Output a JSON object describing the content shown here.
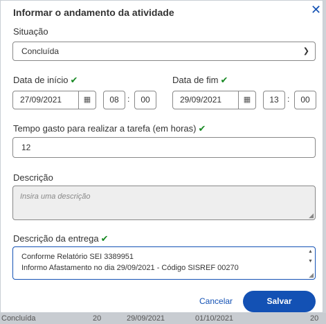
{
  "dialog": {
    "title": "Informar o andamento da atividade",
    "close_glyph": "✕"
  },
  "situacao": {
    "label": "Situação",
    "value": "Concluída"
  },
  "data_inicio": {
    "label": "Data de início",
    "date": "27/09/2021",
    "hour": "08",
    "minute": "00"
  },
  "data_fim": {
    "label": "Data de fim",
    "date": "29/09/2021",
    "hour": "13",
    "minute": "00"
  },
  "tempo": {
    "label": "Tempo gasto para realizar a tarefa (em horas)",
    "value": "12"
  },
  "descricao": {
    "label": "Descrição",
    "placeholder": "Insira uma descrição"
  },
  "descricao_entrega": {
    "label": "Descrição da entrega",
    "line1": "Conforme Relatório SEI 3389951",
    "line2": "Informo Afastamento no dia 29/09/2021 - Código SISREF 00270"
  },
  "actions": {
    "cancel": "Cancelar",
    "save": "Salvar"
  },
  "background_row": {
    "status": "Concluída",
    "num1": "20",
    "date1": "29/09/2021",
    "date2": "01/10/2021",
    "num2": "20"
  },
  "icons": {
    "check": "check-icon",
    "calendar": "calendar-icon",
    "close": "close-icon",
    "chevron": "chevron-down-icon"
  },
  "colors": {
    "primary": "#1351b4",
    "success": "#168821"
  }
}
